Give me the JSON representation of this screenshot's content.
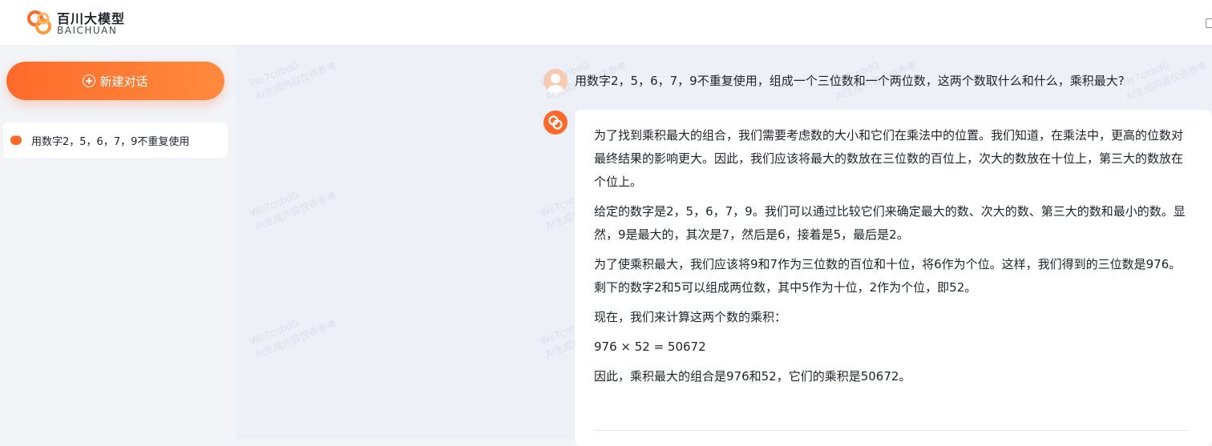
{
  "brand": {
    "name_cn": "百川大模型",
    "name_en": "BAICHUAN"
  },
  "sidebar": {
    "new_chat_label": "新建对话",
    "history": [
      {
        "label": "用数字2，5，6，7，9不重复使用"
      }
    ]
  },
  "conversation": {
    "user_question": "用数字2，5，6，7，9不重复使用，组成一个三位数和一个两位数，这两个数取什么和什么，乘积最大?",
    "answer_paragraphs": [
      "为了找到乘积最大的组合，我们需要考虑数的大小和它们在乘法中的位置。我们知道，在乘法中，更高的位数对最终结果的影响更大。因此，我们应该将最大的数放在三位数的百位上，次大的数放在十位上，第三大的数放在个位上。",
      "给定的数字是2，5，6，7，9。我们可以通过比较它们来确定最大的数、次大的数、第三大的数和最小的数。显然，9是最大的，其次是7，然后是6，接着是5，最后是2。",
      "为了使乘积最大，我们应该将9和7作为三位数的百位和十位，将6作为个位。这样，我们得到的三位数是976。剩下的数字2和5可以组成两位数，其中5作为十位，2作为个位，即52。",
      "现在，我们来计算这两个数的乘积：",
      "976 × 52 = 50672",
      "因此，乘积最大的组合是976和52，它们的乘积是50672。"
    ]
  },
  "watermark": {
    "line1": "We7cnbdG",
    "line2": "AI生成内容仅供参考"
  },
  "colors": {
    "accent": "#ff6a2b",
    "background": "#edf0f6",
    "sidebar_bg": "#f2f4f8"
  }
}
